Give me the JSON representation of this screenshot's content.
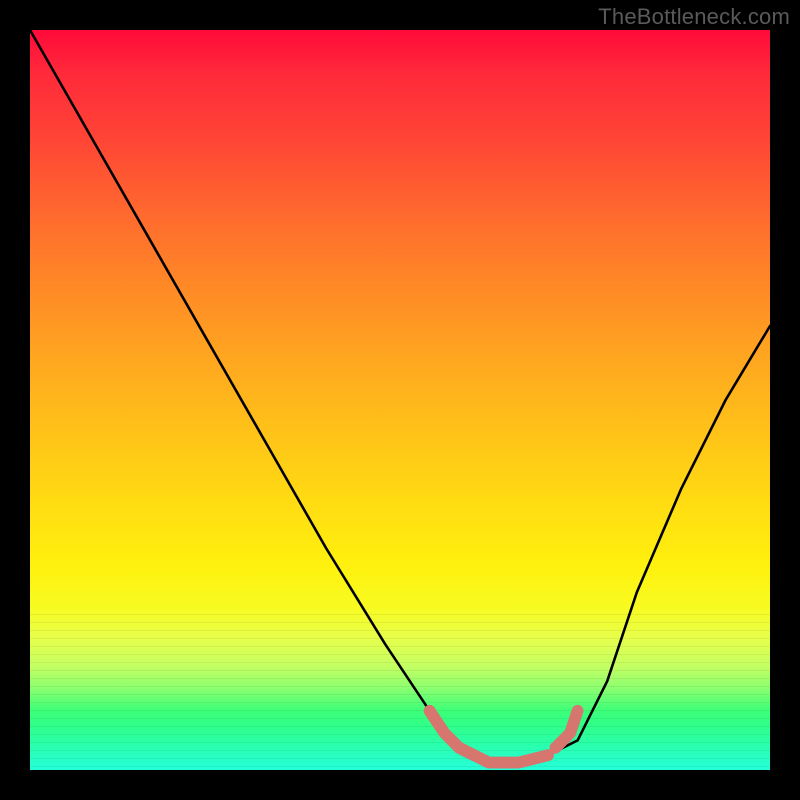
{
  "watermark": "TheBottleneck.com",
  "chart_data": {
    "type": "line",
    "title": "",
    "xlabel": "",
    "ylabel": "",
    "xlim": [
      0,
      100
    ],
    "ylim": [
      0,
      100
    ],
    "grid": false,
    "legend_position": "none",
    "series": [
      {
        "name": "bottleneck-curve",
        "color": "#000000",
        "x": [
          0,
          8,
          16,
          24,
          32,
          40,
          48,
          54,
          58,
          62,
          66,
          70,
          74,
          78,
          82,
          88,
          94,
          100
        ],
        "values": [
          100,
          86,
          72,
          58,
          44,
          30,
          17,
          8,
          3,
          1,
          1,
          2,
          4,
          12,
          24,
          38,
          50,
          60
        ]
      }
    ],
    "highlight_segments": [
      {
        "name": "left-knee",
        "x": [
          54,
          56,
          58,
          60
        ],
        "y": [
          8,
          5,
          3,
          2
        ],
        "color": "#d6766f"
      },
      {
        "name": "flat-bottom",
        "x": [
          58,
          60,
          62,
          64,
          66,
          68,
          70
        ],
        "y": [
          3,
          2,
          1,
          1,
          1,
          1.5,
          2
        ],
        "color": "#d6766f"
      },
      {
        "name": "right-knee",
        "x": [
          71,
          73,
          74
        ],
        "y": [
          3,
          5,
          8
        ],
        "color": "#d6766f"
      }
    ],
    "background": {
      "type": "vertical-gradient",
      "stops": [
        {
          "pos": 0,
          "color": "#ff0a3a"
        },
        {
          "pos": 25,
          "color": "#ff6a2e"
        },
        {
          "pos": 55,
          "color": "#ffc418"
        },
        {
          "pos": 78,
          "color": "#f8fb20"
        },
        {
          "pos": 92,
          "color": "#3cff78"
        },
        {
          "pos": 100,
          "color": "#25ffd8"
        }
      ]
    }
  }
}
